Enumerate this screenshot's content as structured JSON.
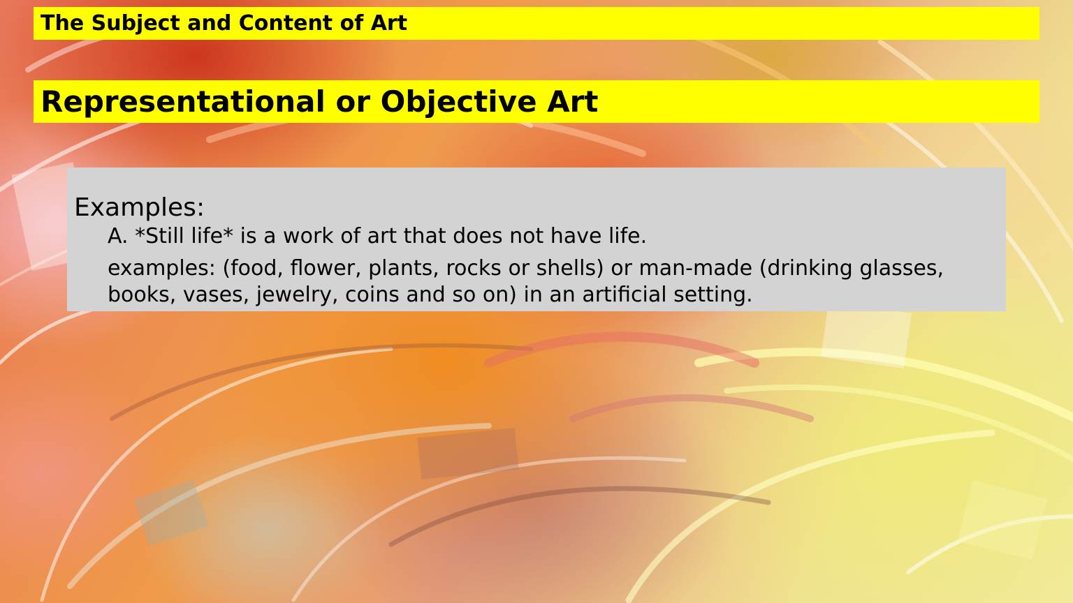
{
  "slide": {
    "title": "The Subject and Content of Art",
    "heading": "Representational or Objective Art",
    "content": {
      "label": "Examples:",
      "item_a": "A. *Still life* is a work of art that does not have life.",
      "item_b": "examples: (food, flower, plants, rocks or shells) or man-made (drinking glasses, books, vases, jewelry, coins and so on) in an artificial setting."
    }
  },
  "colors": {
    "title_bar": "#ffff00",
    "content_box": "#d3d3d3",
    "text": "#000000"
  }
}
